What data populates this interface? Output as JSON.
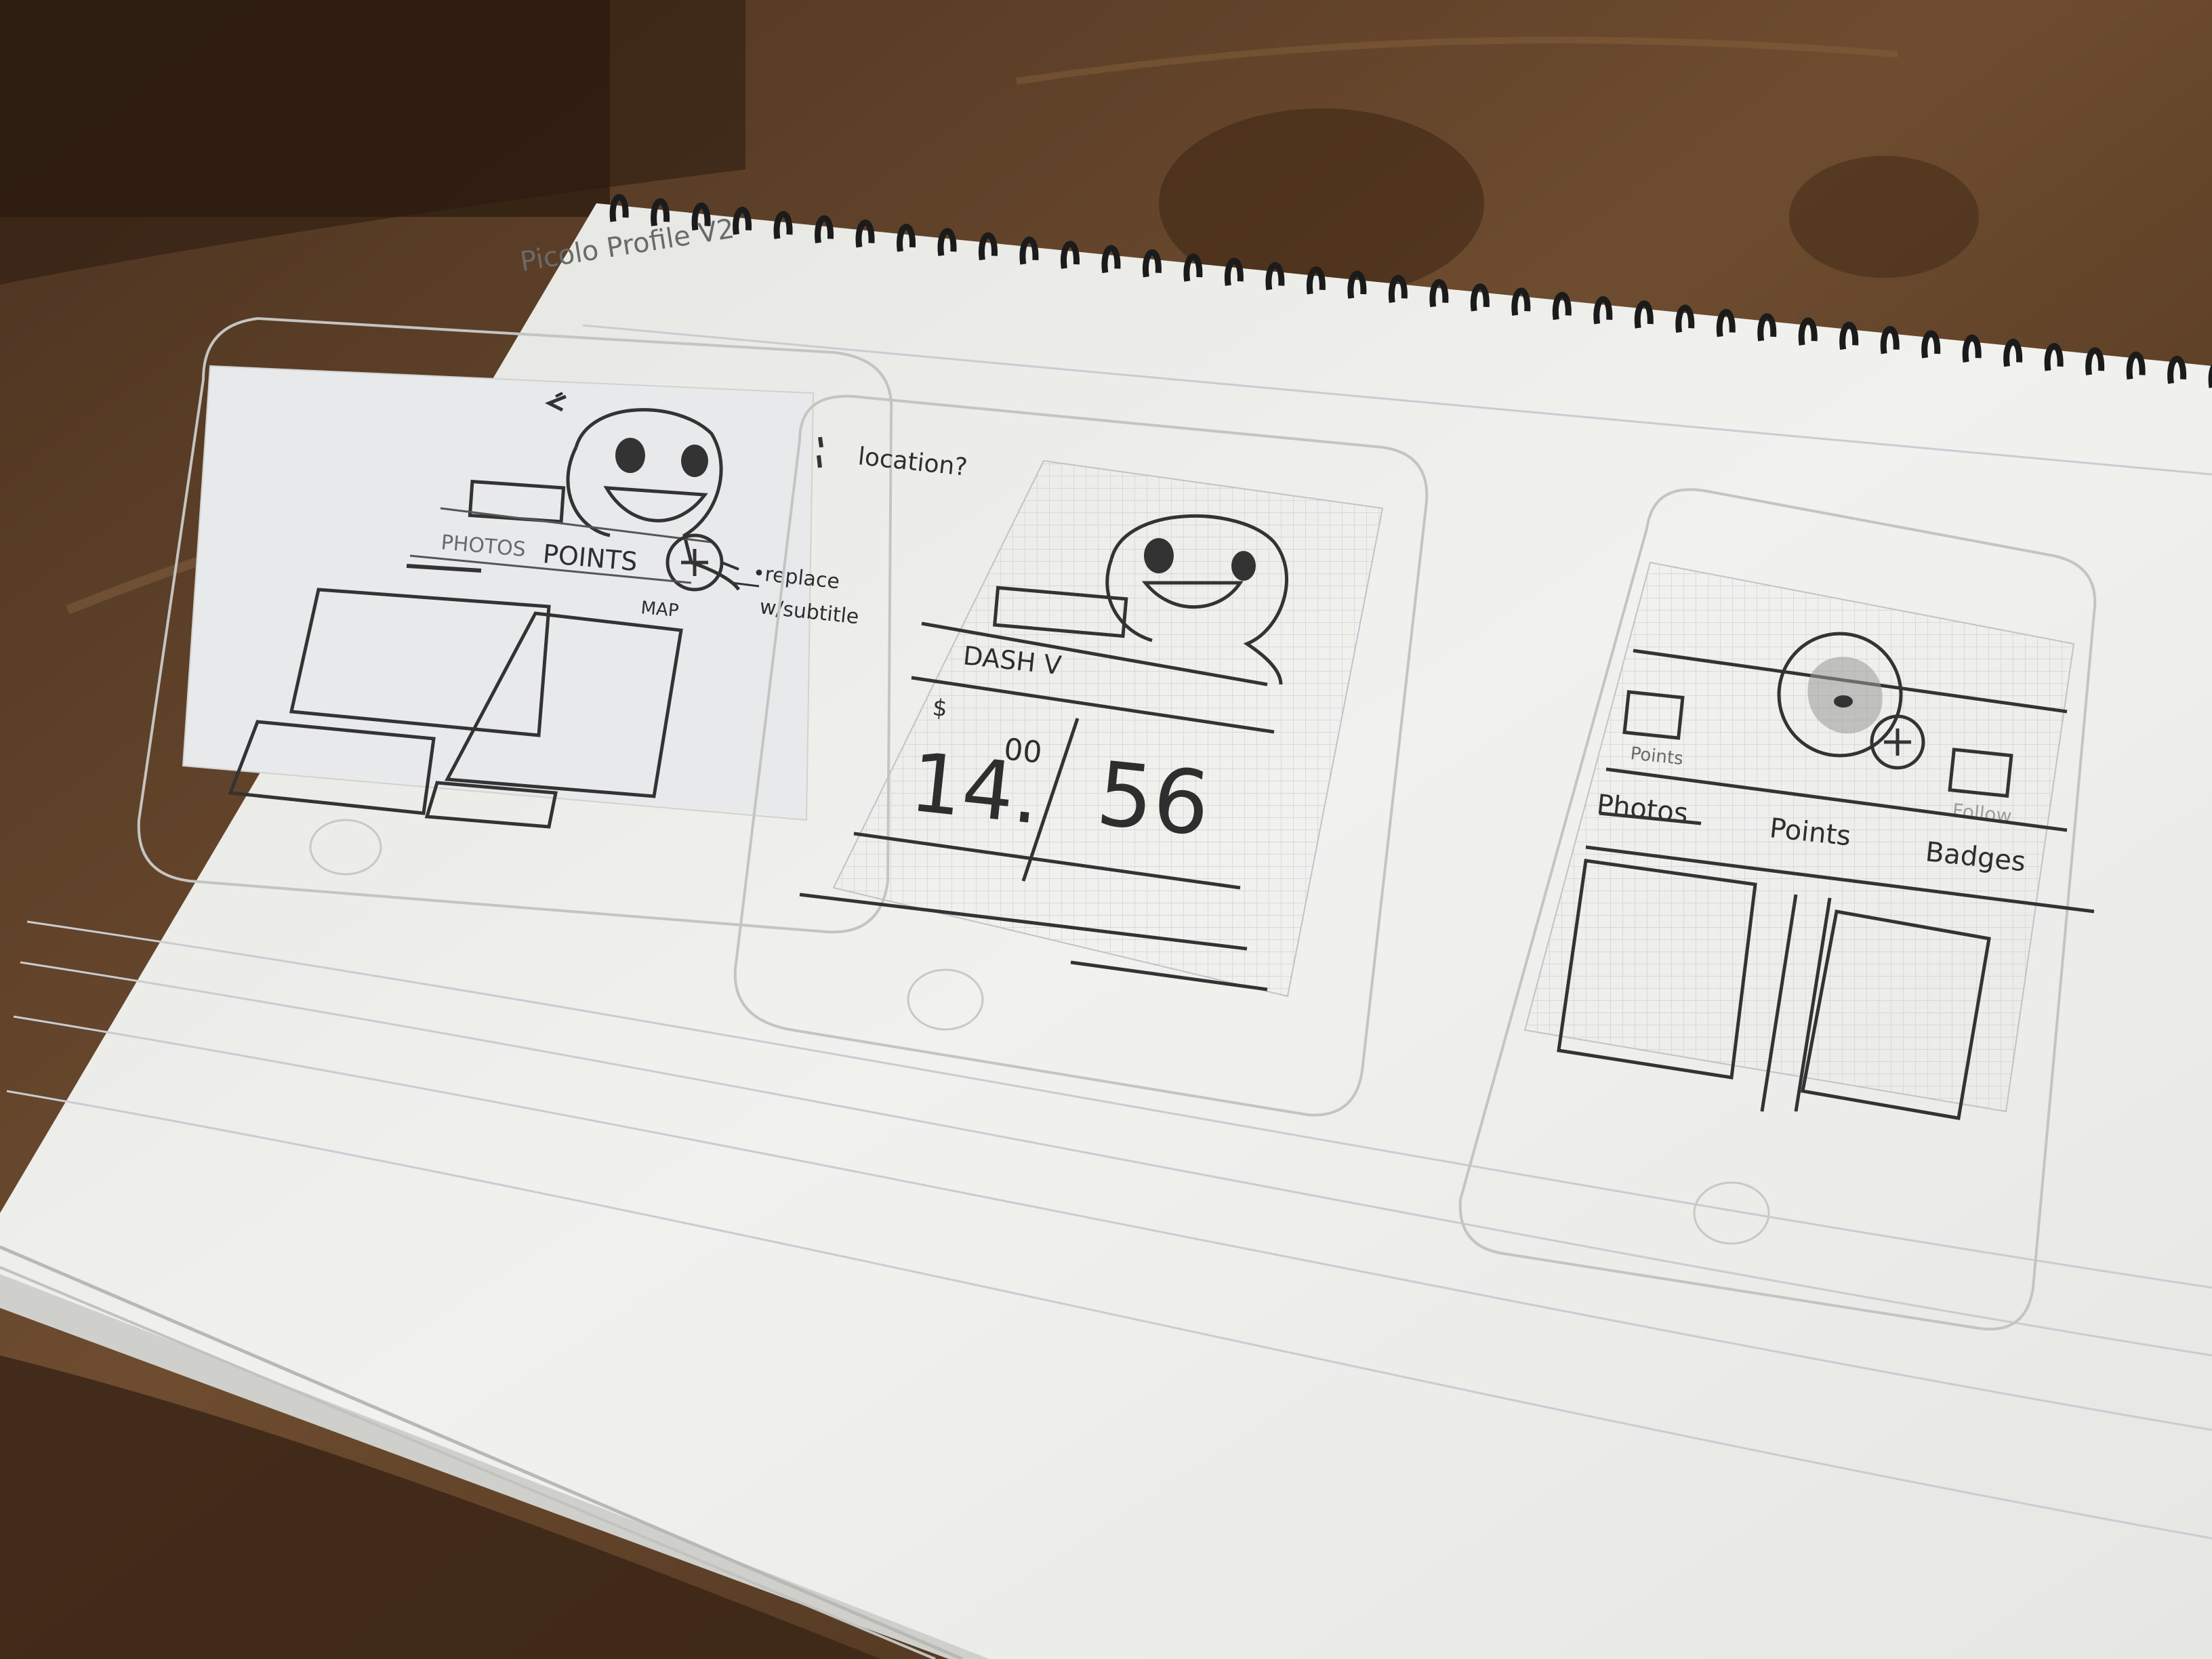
{
  "notebook": {
    "title": "Picolo Profile V2"
  },
  "phone1": {
    "note_location": "location?",
    "note_replace_line1": "•replace",
    "note_replace_line2": "w/subtitle",
    "tab_photos": "PHOTOS",
    "tab_points": "POINTS",
    "tab_map": "MAP"
  },
  "phone2": {
    "header_label": "DASH V",
    "currency_symbol": "$",
    "amount_whole": "14.",
    "amount_cents": "00",
    "count": "56"
  },
  "phone3": {
    "small_label": "Points",
    "faded_label": "Follow",
    "tab_photos": "Photos",
    "tab_points": "Points",
    "tab_badges": "Badges"
  },
  "colors": {
    "wood_dark": "#3a2616",
    "wood_mid": "#6b4a2e",
    "paper": "#efefec",
    "pencil": "#2b2b2b"
  }
}
